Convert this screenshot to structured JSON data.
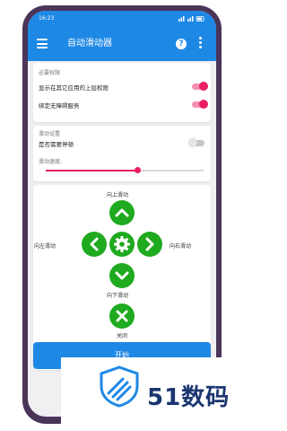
{
  "status_bar": {
    "time": "16:23",
    "right_icons": "wifi, signal, battery"
  },
  "app_bar": {
    "title": "自动滑动器",
    "menu_icon": "hamburger-menu-icon",
    "help_icon": "help-icon",
    "more_icon": "more-vert-icon"
  },
  "permissions": {
    "section_title": "必要权限",
    "overlay_label": "显示在其它应用的上层权限",
    "overlay_on": true,
    "accessibility_label": "绑定无障碍服务",
    "accessibility_on": true
  },
  "swipe_settings": {
    "section_title": "滑动设置",
    "pause_label": "是否需要停顿",
    "pause_on": false,
    "speed_label": "滑动速度:",
    "speed_fraction": 0.58
  },
  "controls": {
    "up_label": "向上滑动",
    "left_label": "向左滑动",
    "right_label": "向右滑动",
    "down_label": "向下滑动",
    "close_label": "关闭",
    "button_color": "#1faa1f"
  },
  "start_button": {
    "label": "开始"
  },
  "colors": {
    "primary": "#1e88e5",
    "accent": "#e91e63"
  },
  "watermark": {
    "text": "51数码"
  }
}
